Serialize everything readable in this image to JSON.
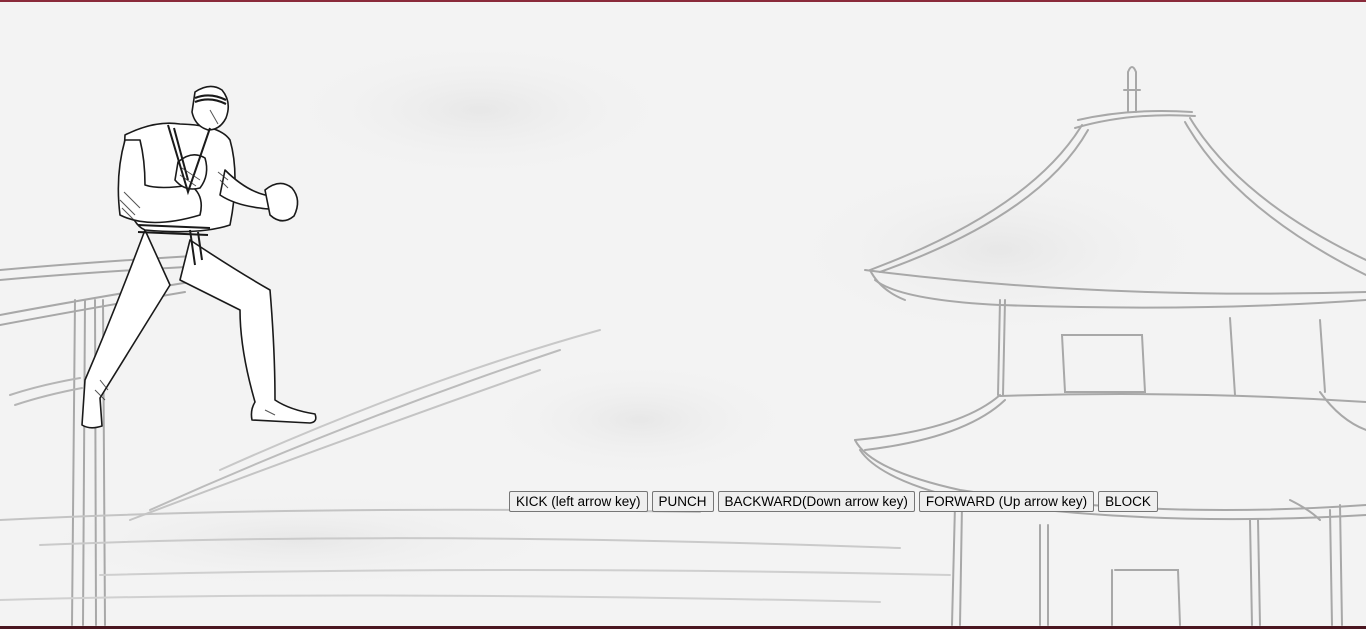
{
  "game": {
    "scene": "sketched dojo temple background",
    "fighter_icon": "karate-fighter-icon"
  },
  "controls": {
    "kick_label": "KICK (left arrow key)",
    "punch_label": "PUNCH",
    "backward_label": "BACKWARD(Down arrow key)",
    "forward_label": "FORWARD (Up arrow key)",
    "block_label": "BLOCK"
  },
  "colors": {
    "background": "#f3f3f3",
    "sketch_line": "#9a9a9a",
    "top_border": "#8a2a3a",
    "bottom_border": "#4a1620"
  }
}
